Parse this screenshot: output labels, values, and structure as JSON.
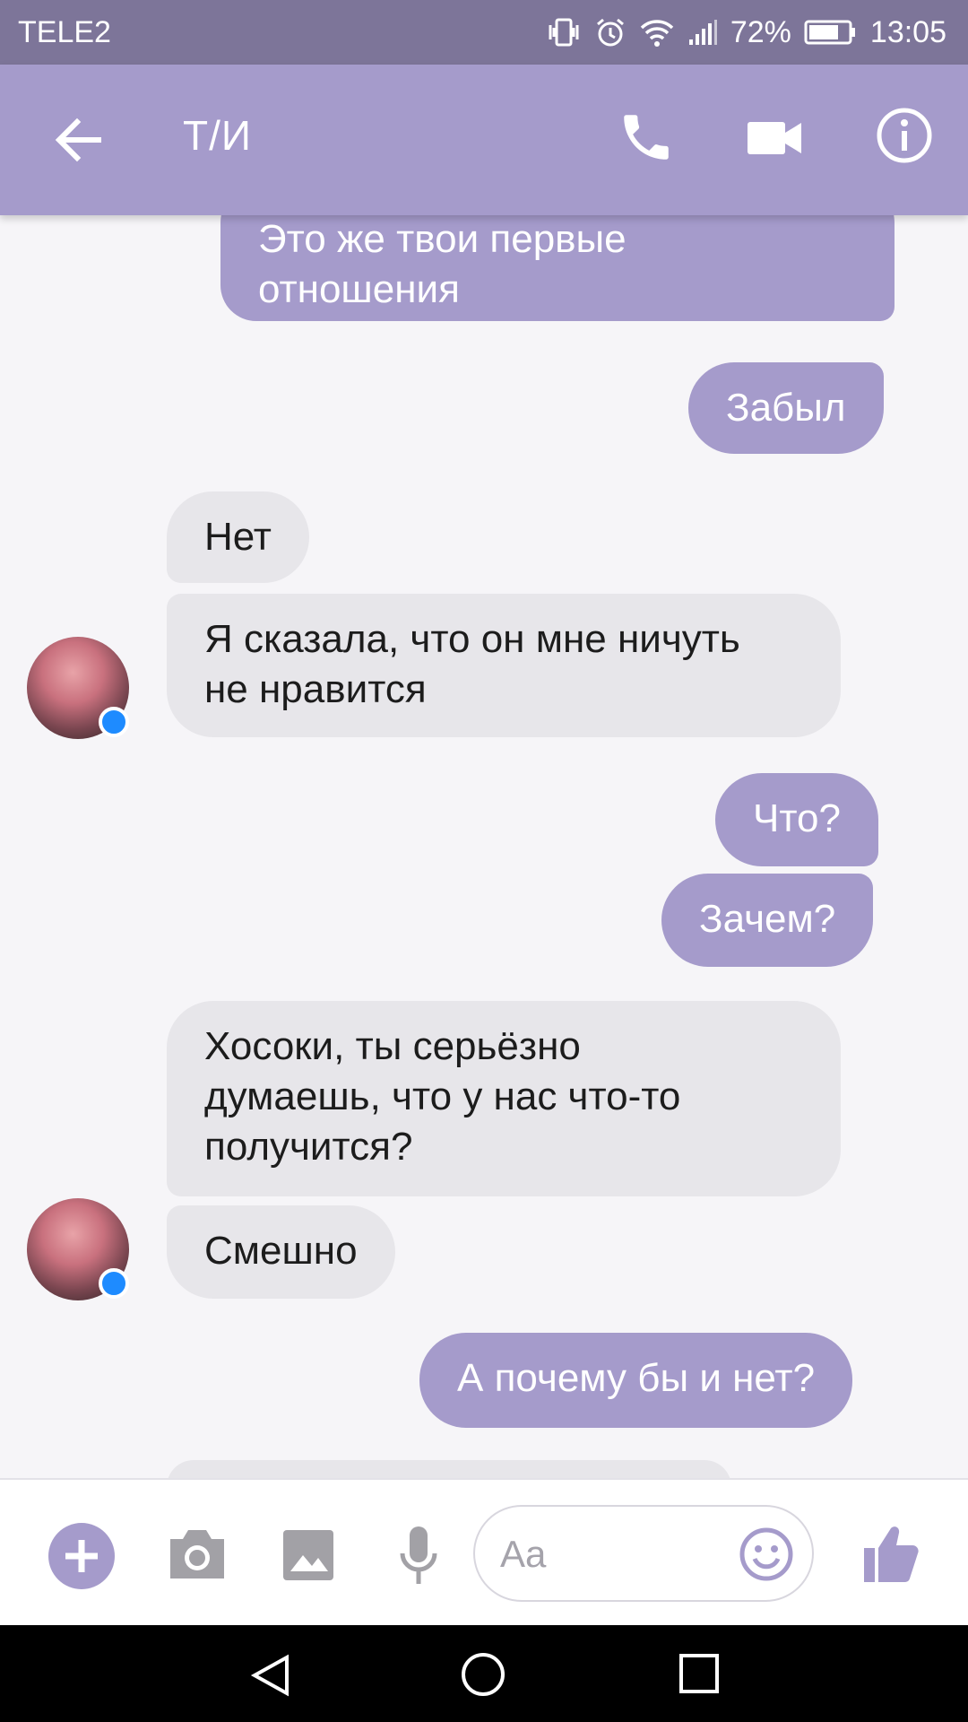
{
  "status_bar": {
    "carrier": "TELE2",
    "battery": "72%",
    "time": "13:05",
    "icons": [
      "vibrate-icon",
      "alarm-icon",
      "wifi-icon",
      "signal-icon",
      "battery-icon"
    ]
  },
  "header": {
    "title": "Т/И",
    "icons": [
      "back-arrow-icon",
      "phone-icon",
      "video-camera-icon",
      "info-icon"
    ]
  },
  "messages": [
    {
      "direction": "out",
      "text": "Это же твои первые\nотношения"
    },
    {
      "direction": "out",
      "text": "Забыл"
    },
    {
      "direction": "in",
      "text": "Нет"
    },
    {
      "direction": "in",
      "text": "Я сказала, что он мне ничуть\nне нравится"
    },
    {
      "direction": "out",
      "text": "Что?"
    },
    {
      "direction": "out",
      "text": "Зачем?"
    },
    {
      "direction": "in",
      "text": "Хосоки, ты серьёзно\nдумаешь, что у нас что-то\nполучится?"
    },
    {
      "direction": "in",
      "text": "Смешно"
    },
    {
      "direction": "out",
      "text": "А почему бы и нет?"
    }
  ],
  "composer": {
    "placeholder": "Aa",
    "icons": [
      "plus-icon",
      "camera-icon",
      "image-icon",
      "microphone-icon",
      "smiley-icon",
      "thumbs-up-icon"
    ]
  },
  "nav_bar": {
    "icons": [
      "nav-back-icon",
      "nav-home-icon",
      "nav-recents-icon"
    ]
  },
  "colors": {
    "status_bar": "#7d7599",
    "accent": "#a59bcb",
    "incoming_bubble": "#e7e6ea",
    "background": "#f6f5f8",
    "messenger_badge": "#1e8bff"
  }
}
